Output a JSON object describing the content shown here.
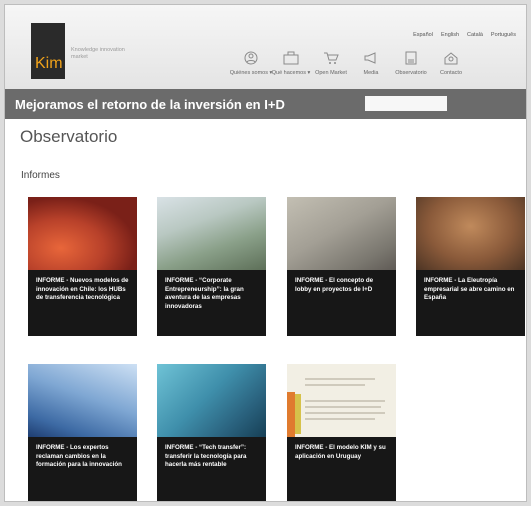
{
  "header": {
    "logo_text": "Kim",
    "tagline": "Knowledge innovation market",
    "languages": [
      "Español",
      "English",
      "Català",
      "Português"
    ],
    "nav": [
      {
        "label": "Quiénes somos ▾",
        "icon": "people-icon"
      },
      {
        "label": "Qué hacemos ▾",
        "icon": "briefcase-icon"
      },
      {
        "label": "Open Market",
        "icon": "cart-icon"
      },
      {
        "label": "Media",
        "icon": "megaphone-icon"
      },
      {
        "label": "Observatorio",
        "icon": "document-icon"
      },
      {
        "label": "Contacto",
        "icon": "contact-icon"
      }
    ]
  },
  "banner": {
    "title": "Mejoramos el retorno de la inversión en I+D",
    "search_placeholder": ""
  },
  "main": {
    "page_title": "Observatorio",
    "section_title": "Informes",
    "cards": [
      {
        "caption": "INFORME - Nuevos modelos de innovación en Chile: los HUBs de transferencia tecnológica"
      },
      {
        "caption": "INFORME - “Corporate Entrepreneurship”: la gran aventura de las empresas innovadoras"
      },
      {
        "caption": "INFORME - El concepto de lobby en proyectos de I+D"
      },
      {
        "caption": "INFORME - La Eleutropía empresarial se abre camino en España"
      },
      {
        "caption": "INFORME - Los expertos reclaman cambios en la formación para la innovación"
      },
      {
        "caption": "INFORME - “Tech transfer”: transferir la tecnología para hacerla más rentable"
      },
      {
        "caption": "INFORME - El modelo KIM y su aplicación en Uruguay"
      }
    ]
  },
  "colors": {
    "brand_orange": "#f0a21a",
    "banner_gray": "#6b6b6b",
    "card_dark": "#171717"
  }
}
